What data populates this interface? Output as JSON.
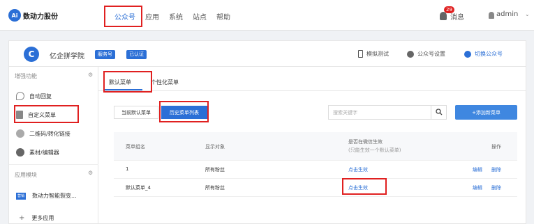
{
  "header": {
    "logo_badge": "Ai",
    "logo_text": "数动力股份",
    "nav": [
      "公众号",
      "应用",
      "系统",
      "站点",
      "帮助"
    ],
    "notifications_count": "29",
    "notifications_label": "消息",
    "username": "admin",
    "caret": "⌄"
  },
  "account": {
    "logo_glyph": "C",
    "name": "亿企拼学院",
    "tags": [
      "服务号",
      "已认证"
    ],
    "tools": [
      "模拟测试",
      "公众号设置",
      "切换公众号"
    ]
  },
  "sidebar": {
    "section1": "增强功能",
    "items": [
      "自动回复",
      "自定义菜单",
      "二维码/转化链接",
      "素材/编辑器"
    ],
    "section2": "应用模块",
    "app_icon_text": "营销",
    "app_item": "数动力智能裂变...",
    "more_apps": "更多应用",
    "gear": "⚙",
    "plus": "+"
  },
  "tabs": [
    "默认菜单",
    "个性化菜单"
  ],
  "toolbar": {
    "current_menu": "当前默认菜单",
    "history_list": "历史菜单列表",
    "search_placeholder": "搜索关键字",
    "add_button": "+添加新菜单"
  },
  "table": {
    "columns": [
      "菜单组名",
      "显示对象",
      "是否在微信生效",
      "(只能生效一个默认菜单)",
      "操作"
    ],
    "rows": [
      {
        "name": "1",
        "target": "所有粉丝",
        "status": "点击生效",
        "edit": "编辑",
        "delete": "删除"
      },
      {
        "name": "默认菜单_4",
        "target": "所有粉丝",
        "status": "点击生效",
        "edit": "编辑",
        "delete": "删除"
      }
    ]
  },
  "colors": {
    "accent": "#2b6fd6",
    "highlight": "#e02020"
  }
}
